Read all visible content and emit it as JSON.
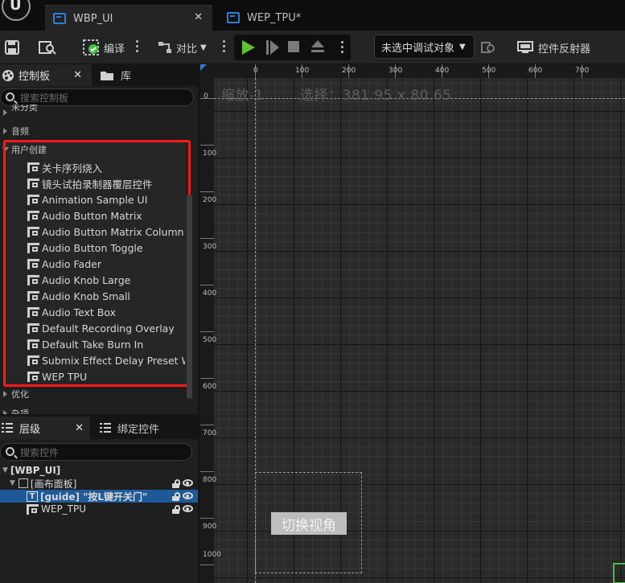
{
  "tabs": [
    {
      "label": "WBP_UI",
      "active": true
    },
    {
      "label": "WEP_TPU*",
      "active": false
    }
  ],
  "toolbar": {
    "compile_label": "编译",
    "diff_label": "对比",
    "debug_target": "未选中调试对象",
    "reflector_label": "控件反射器"
  },
  "palette": {
    "tab_label": "控制板",
    "library_label": "库",
    "search_placeholder": "搜索控制板",
    "categories": [
      "未分类",
      "音频",
      "用户创建",
      "优化",
      "杂项"
    ],
    "user_items": [
      "关卡序列烧入",
      "镜头试拍录制器覆层控件",
      "Animation Sample UI",
      "Audio Button Matrix",
      "Audio Button Matrix Column",
      "Audio Button Toggle",
      "Audio Fader",
      "Audio Knob Large",
      "Audio Knob Small",
      "Audio Text Box",
      "Default Recording Overlay",
      "Default Take Burn In",
      "Submix Effect Delay Preset Widget",
      "WEP TPU"
    ]
  },
  "hierarchy": {
    "tab_label": "层级",
    "bind_label": "绑定控件",
    "search_placeholder": "搜索控件",
    "root": "[WBP_UI]",
    "canvas": "[画布面板]",
    "text_widget": "[guide] \"按L键开关门\"",
    "wep": "WEP_TPU"
  },
  "designer": {
    "zoom_text": "缩放-1",
    "selection_text": "选择：381.95 x 80.65",
    "ruler_h": [
      "0",
      "100",
      "200",
      "300",
      "400",
      "500",
      "600",
      "700"
    ],
    "ruler_v": [
      "0",
      "100",
      "200",
      "300",
      "400",
      "500",
      "600",
      "700",
      "800",
      "900",
      "1000"
    ],
    "switch_view_button": "切换视角"
  },
  "colors": {
    "highlight_red": "#ff1a1a",
    "selection_blue": "#1e5a98",
    "play_green": "#5ec232"
  }
}
